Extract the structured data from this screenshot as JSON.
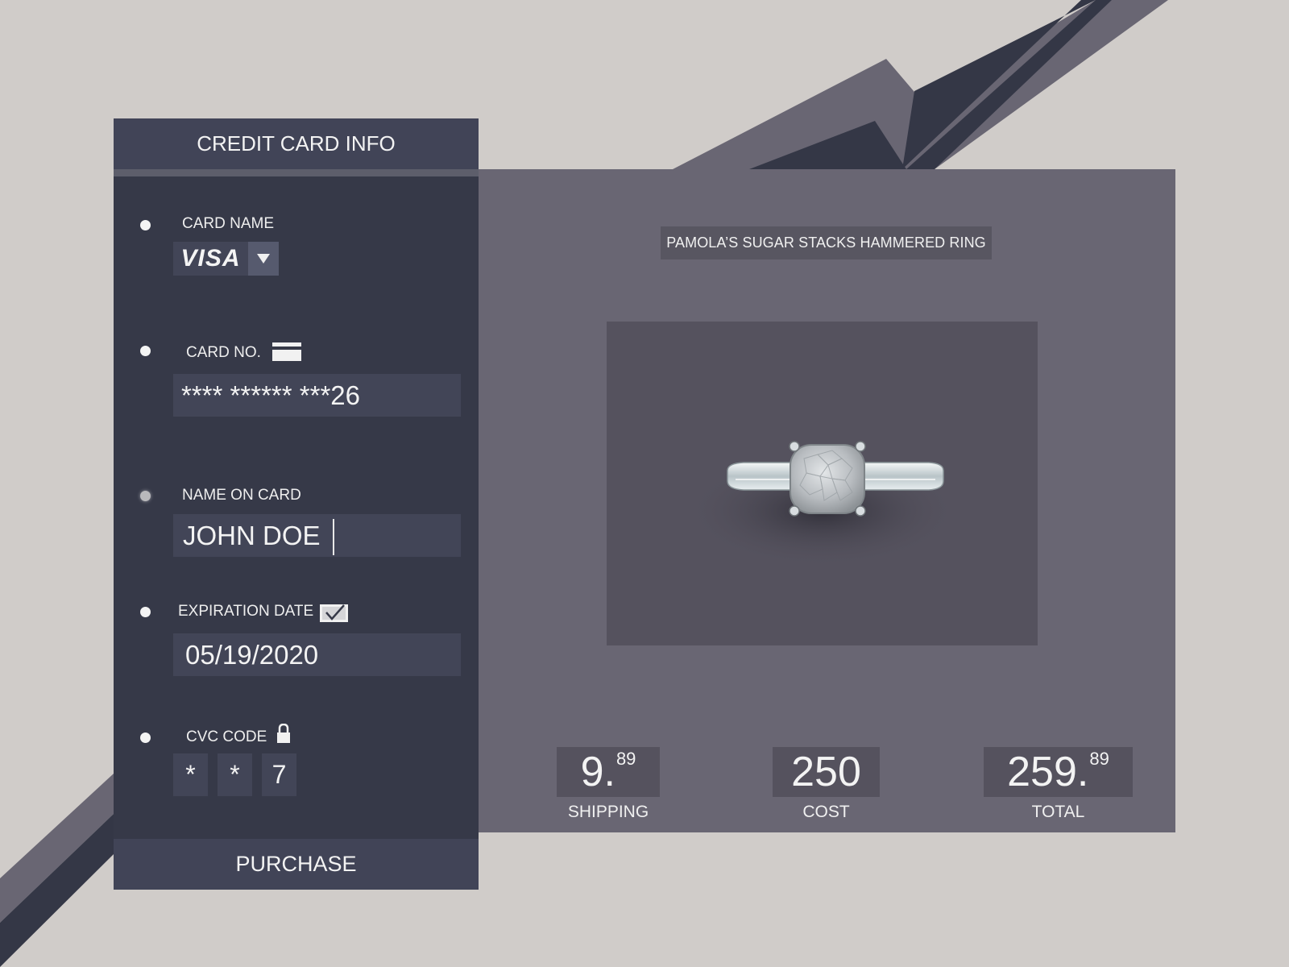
{
  "card_panel": {
    "header": "CREDIT CARD INFO",
    "fields": {
      "card_name": {
        "label": "CARD NAME",
        "value": "VISA"
      },
      "card_no": {
        "label": "CARD NO.",
        "value": "**** ****** ***26"
      },
      "name_on_card": {
        "label": "NAME ON CARD",
        "value": "JOHN DOE"
      },
      "expiration": {
        "label": "EXPIRATION DATE",
        "value": "05/19/2020"
      },
      "cvc": {
        "label": "CVC CODE",
        "digits": [
          "*",
          "*",
          "7"
        ]
      }
    },
    "purchase_label": "PURCHASE"
  },
  "product": {
    "title": "PAMOLA’S SUGAR STACKS HAMMERED RING",
    "image": "silver-hammered-ring"
  },
  "pricing": {
    "shipping": {
      "main": "9.",
      "cents": "89",
      "label": "SHIPPING"
    },
    "cost": {
      "main": "250",
      "label": "COST"
    },
    "total": {
      "main": "259.",
      "cents": "89",
      "label": "TOTAL"
    }
  },
  "icons": {
    "card_name_dropdown": "chevron-down-icon",
    "card_no": "credit-card-icon",
    "expiration": "checkbox-checked-icon",
    "cvc": "lock-icon"
  },
  "colors": {
    "background": "#d0ccc9",
    "card_panel": "#363948",
    "header": "#414457",
    "product_panel": "#696673",
    "accent_dark": "#343746"
  }
}
